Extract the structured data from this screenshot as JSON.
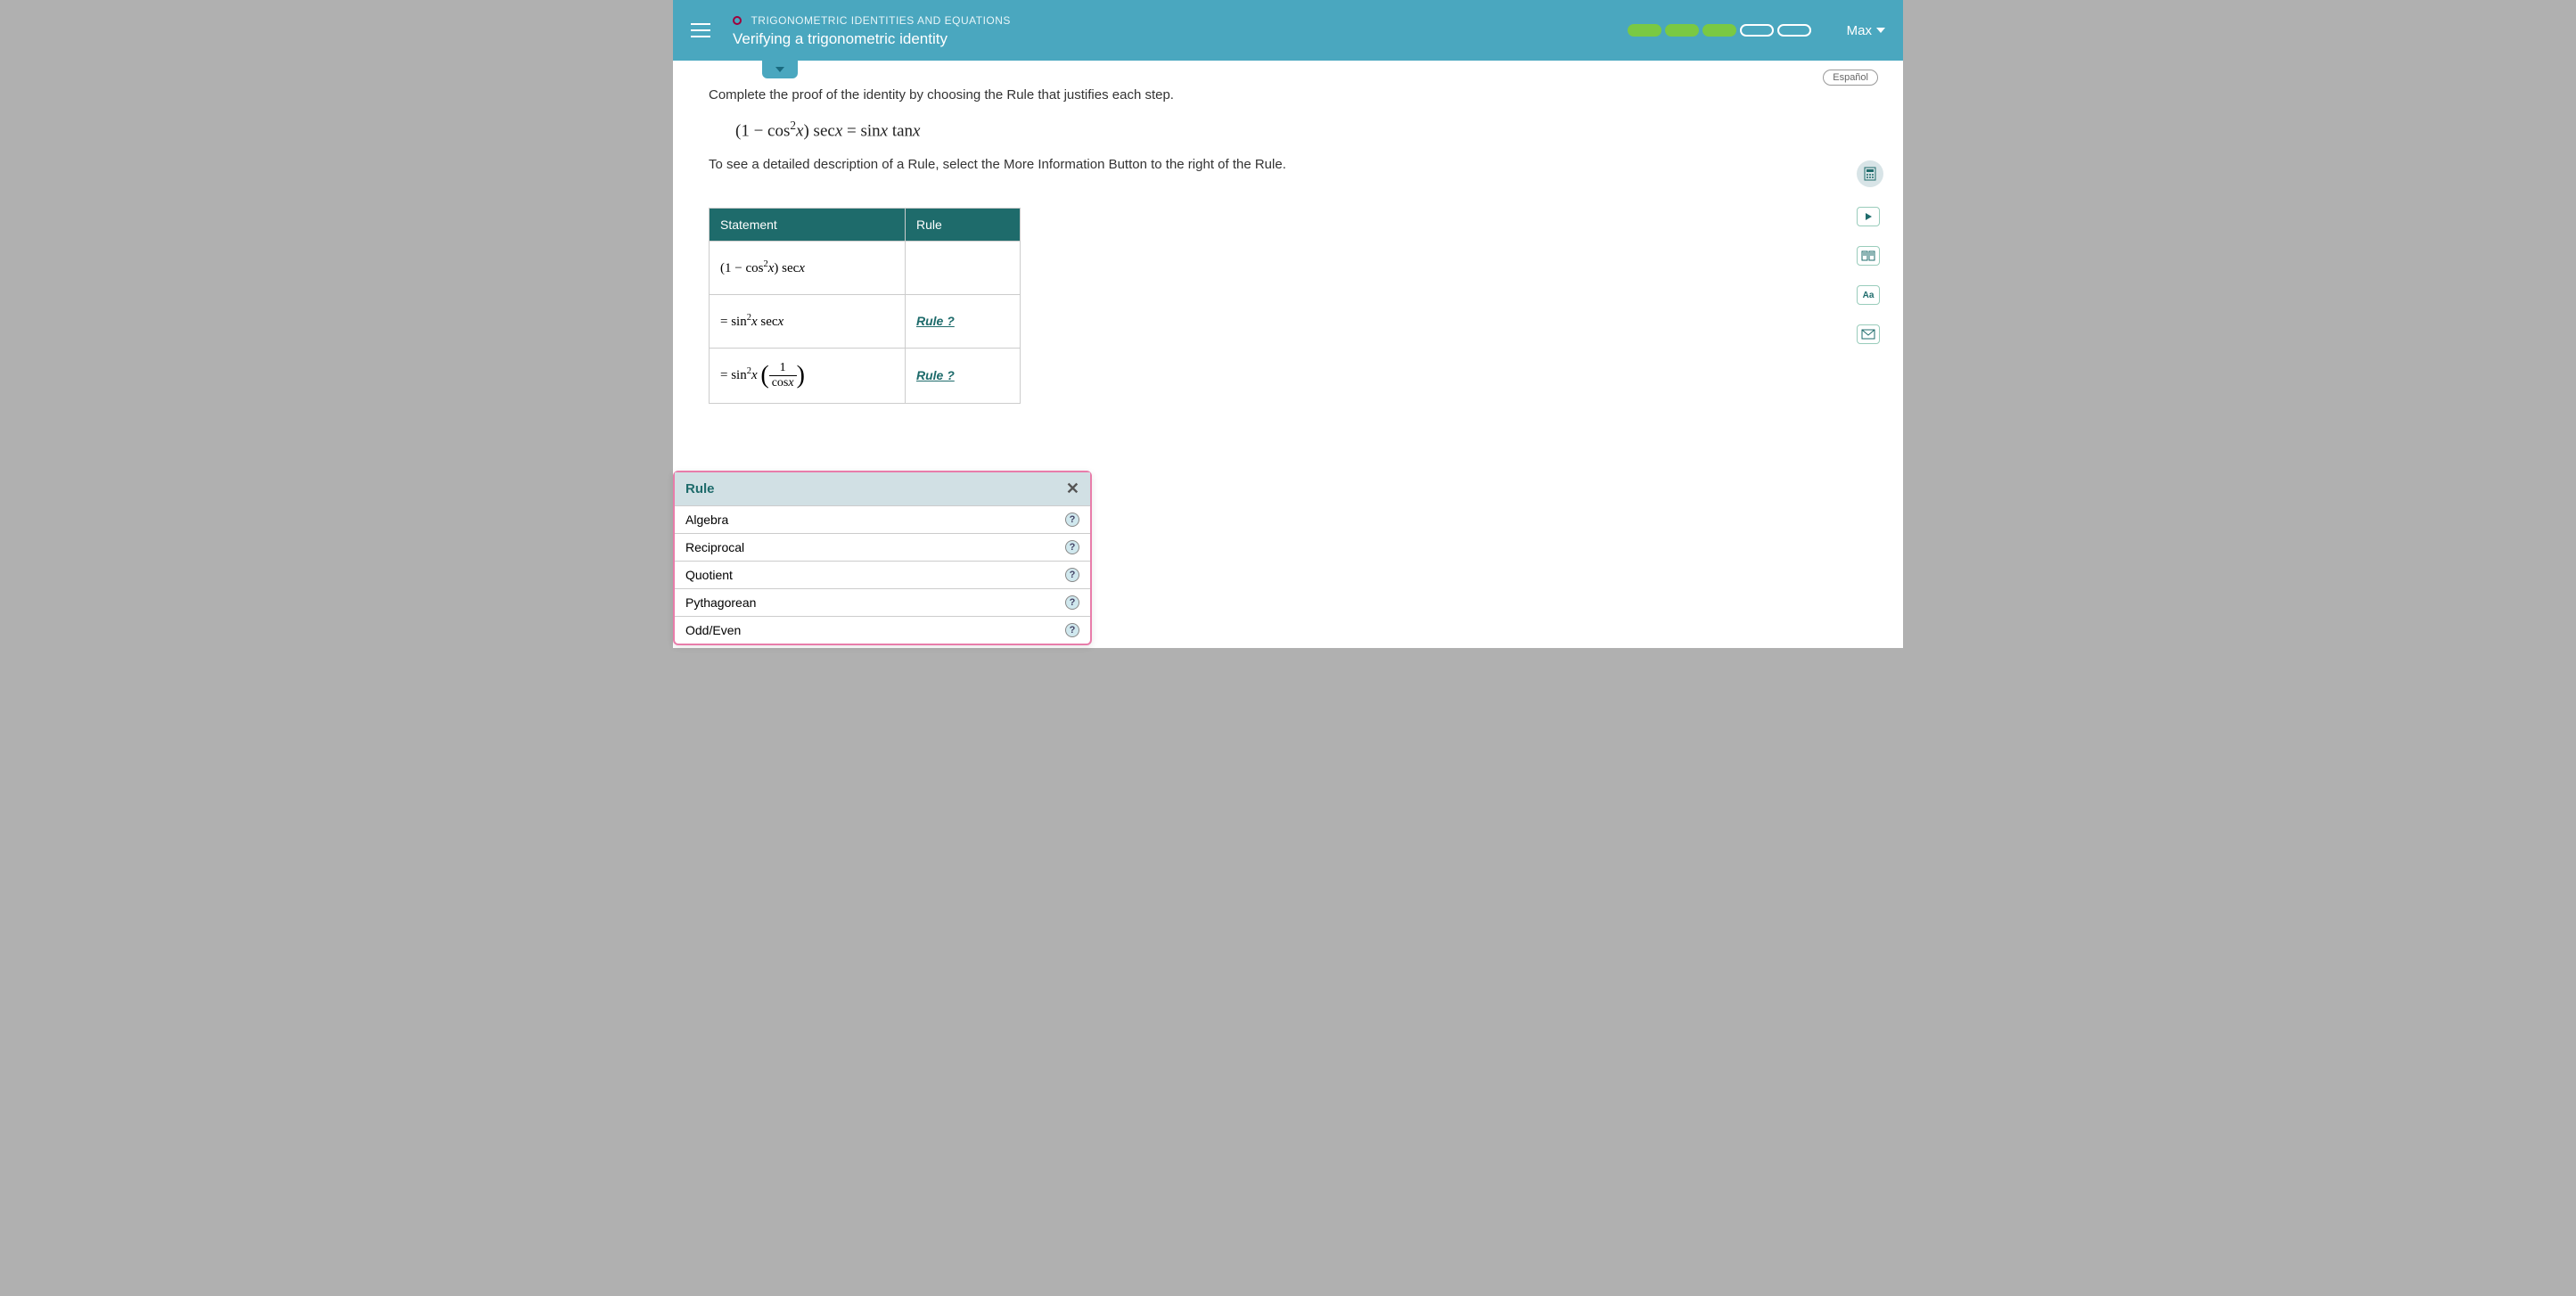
{
  "header": {
    "category": "TRIGONOMETRIC IDENTITIES AND EQUATIONS",
    "title": "Verifying a trigonometric identity",
    "user": "Max",
    "progress_total": 5,
    "progress_filled": 3
  },
  "lang_button": "Español",
  "instruction": "Complete the proof of the identity by choosing the Rule that justifies each step.",
  "identity_latex": "(1 − cos²x) sec x = sin x tan x",
  "sub_instruction": "To see a detailed description of a Rule, select the More Information Button to the right of the Rule.",
  "table": {
    "col1": "Statement",
    "col2": "Rule",
    "rows": [
      {
        "statement_plain": "(1 − cos²x) sec x",
        "rule": ""
      },
      {
        "statement_plain": "= sin²x sec x",
        "rule": "Rule ?"
      },
      {
        "statement_plain": "= sin²x (1 / cos x)",
        "rule": "Rule ?"
      }
    ]
  },
  "rule_popup": {
    "title": "Rule",
    "options": [
      "Algebra",
      "Reciprocal",
      "Quotient",
      "Pythagorean",
      "Odd/Even"
    ]
  },
  "side_tools": {
    "calculator": "calculator",
    "video": "video",
    "book": "textbook",
    "glossary": "Aa",
    "message": "message"
  }
}
